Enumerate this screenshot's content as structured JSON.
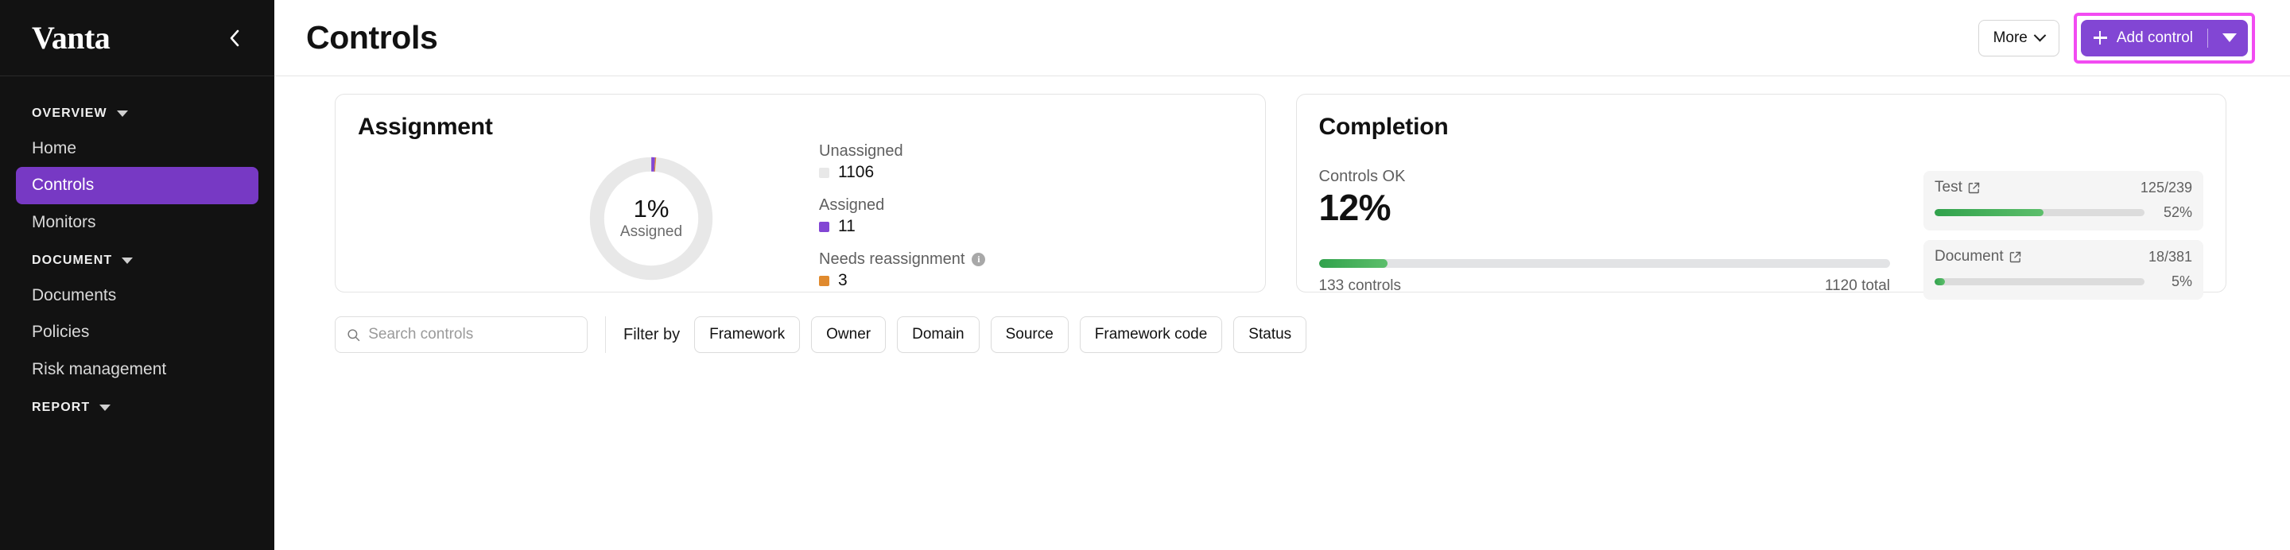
{
  "sidebar": {
    "brand": "Vanta",
    "collapse_icon": "chevron-left-icon",
    "sections": [
      {
        "label": "OVERVIEW",
        "items": [
          {
            "label": "Home",
            "active": false
          },
          {
            "label": "Controls",
            "active": true
          },
          {
            "label": "Monitors",
            "active": false
          }
        ]
      },
      {
        "label": "DOCUMENT",
        "items": [
          {
            "label": "Documents",
            "active": false
          },
          {
            "label": "Policies",
            "active": false
          },
          {
            "label": "Risk management",
            "active": false
          }
        ]
      },
      {
        "label": "REPORT",
        "items": []
      }
    ],
    "active_bg": "#7739C4"
  },
  "header": {
    "title": "Controls",
    "more_label": "More",
    "add_control_label": "Add control",
    "add_control_bg": "#8246D4",
    "highlight_color": "#F24BF2"
  },
  "assignment": {
    "title": "Assignment",
    "center_value": "1%",
    "center_label": "Assigned",
    "legend": [
      {
        "label": "Unassigned",
        "value": "1106",
        "color": "#e8e8e8",
        "info": false
      },
      {
        "label": "Assigned",
        "value": "11",
        "color": "#8246D4",
        "info": false
      },
      {
        "label": "Needs reassignment",
        "value": "3",
        "color": "#E08A2E",
        "info": true
      }
    ]
  },
  "completion": {
    "title": "Completion",
    "controls_ok_label": "Controls OK",
    "controls_ok_pct": "12%",
    "bar_percent": 12,
    "bar_color": "#31A24C",
    "controls_done": "133 controls",
    "controls_total": "1120 total",
    "breakdown": [
      {
        "name": "Test",
        "icon": "external-link-icon",
        "count": "125/239",
        "percent": 52,
        "percent_label": "52%"
      },
      {
        "name": "Document",
        "icon": "external-link-icon",
        "count": "18/381",
        "percent": 5,
        "percent_label": "5%"
      }
    ]
  },
  "filters": {
    "search_placeholder": "Search controls",
    "search_value": "",
    "search_icon": "search-icon",
    "filter_by_label": "Filter by",
    "chips": [
      {
        "label": "Framework"
      },
      {
        "label": "Owner"
      },
      {
        "label": "Domain"
      },
      {
        "label": "Source"
      },
      {
        "label": "Framework code"
      },
      {
        "label": "Status"
      }
    ]
  },
  "chart_data": {
    "type": "pie",
    "title": "Assignment",
    "categories": [
      "Unassigned",
      "Assigned",
      "Needs reassignment"
    ],
    "values": [
      1106,
      11,
      3
    ],
    "colors": [
      "#e8e8e8",
      "#8246D4",
      "#E08A2E"
    ],
    "total": 1120,
    "center_value": "1%",
    "center_label": "Assigned",
    "legend_position": "right",
    "donut": true
  }
}
